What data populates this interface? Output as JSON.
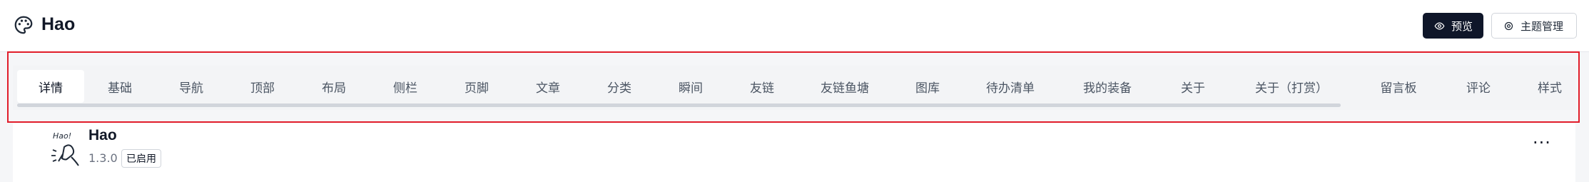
{
  "header": {
    "title": "Hao",
    "icon": "palette-icon",
    "preview_label": "预览",
    "theme_manage_label": "主题管理"
  },
  "tabs": [
    {
      "label": "详情",
      "active": true
    },
    {
      "label": "基础"
    },
    {
      "label": "导航"
    },
    {
      "label": "顶部"
    },
    {
      "label": "布局"
    },
    {
      "label": "侧栏"
    },
    {
      "label": "页脚"
    },
    {
      "label": "文章"
    },
    {
      "label": "分类"
    },
    {
      "label": "瞬间"
    },
    {
      "label": "友链"
    },
    {
      "label": "友链鱼塘"
    },
    {
      "label": "图库"
    },
    {
      "label": "待办清单"
    },
    {
      "label": "我的装备"
    },
    {
      "label": "关于"
    },
    {
      "label": "关于（打赏）"
    },
    {
      "label": "留言板"
    },
    {
      "label": "评论"
    },
    {
      "label": "样式"
    }
  ],
  "theme_card": {
    "name": "Hao",
    "version": "1.3.0",
    "status": "已启用",
    "logo_text": "Hao!",
    "more_label": "···"
  },
  "colors": {
    "primary_button": "#0f1629",
    "highlight_border": "#e11d2a",
    "background": "#f5f6f8"
  }
}
